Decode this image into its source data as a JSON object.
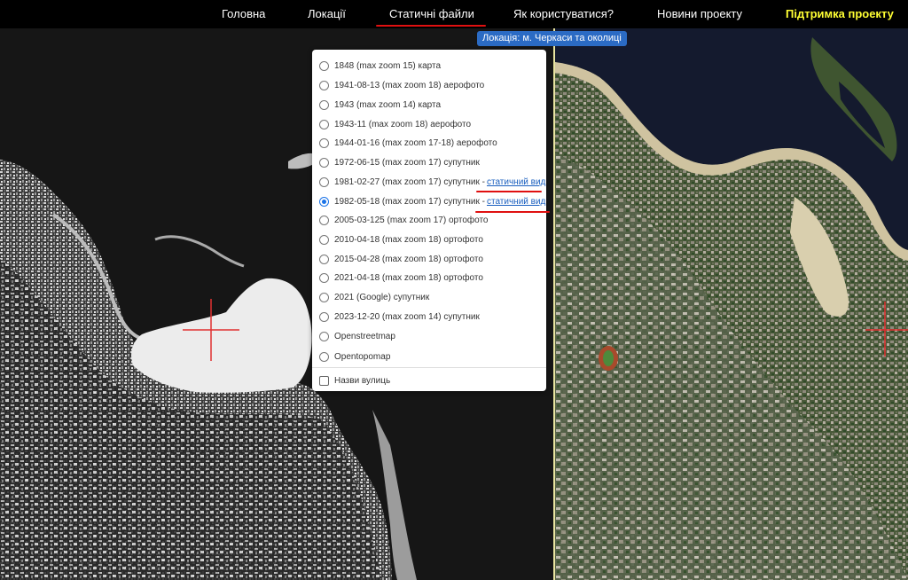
{
  "nav": {
    "items": [
      {
        "label": "Головна"
      },
      {
        "label": "Локації"
      },
      {
        "label": "Статичні файли"
      },
      {
        "label": "Як користуватися?"
      },
      {
        "label": "Новини проекту"
      },
      {
        "label": "Підтримка проекту"
      }
    ],
    "support_color": "#ffff33"
  },
  "location_badge": "Локація: м. Черкаси та околиці",
  "layers": {
    "options": [
      {
        "label": "1848 (max zoom 15) карта"
      },
      {
        "label": "1941-08-13 (max zoom 18) аерофото"
      },
      {
        "label": "1943 (max zoom 14) карта"
      },
      {
        "label": "1943-11 (max zoom 18) аерофото"
      },
      {
        "label": "1944-01-16 (max zoom 17-18) аерофото"
      },
      {
        "label": "1972-06-15 (max zoom 17) супутник"
      },
      {
        "label": "1981-02-27 (max zoom 17) супутник -",
        "link": "статичний вид"
      },
      {
        "label": "1982-05-18 (max zoom 17) супутник -",
        "link": "статичний вид"
      },
      {
        "label": "2005-03-125 (max zoom 17) ортофото"
      },
      {
        "label": "2010-04-18 (max zoom 18) ортофото"
      },
      {
        "label": "2015-04-28 (max zoom 18) ортофото"
      },
      {
        "label": "2021-04-18 (max zoom 18) ортофото"
      },
      {
        "label": "2021 (Google) супутник"
      },
      {
        "label": "2023-12-20 (max zoom 14) супутник"
      },
      {
        "label": "Openstreetmap"
      },
      {
        "label": "Opentopomap"
      }
    ],
    "selected_index": 7,
    "overlay_label": "Назви вулиць",
    "overlay_checked": false
  },
  "colors": {
    "highlight": "#e01010",
    "link": "#1a5fbf",
    "crosshair": "#e03030"
  }
}
